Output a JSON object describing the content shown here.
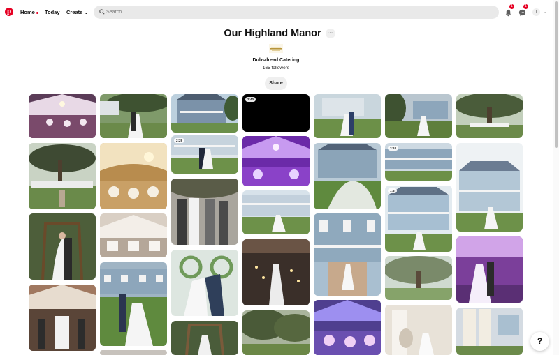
{
  "nav": {
    "home": "Home",
    "today": "Today",
    "create": "Create"
  },
  "search": {
    "placeholder": "Search"
  },
  "notifications": {
    "bell_count": "1",
    "messages_count": "1"
  },
  "account": {
    "initial": "T"
  },
  "board": {
    "title": "Our Highland Manor",
    "more": "···",
    "owner": "Dubsdread Catering",
    "followers": "165 followers",
    "share": "Share"
  },
  "pins": {
    "video_durations": [
      "2:40",
      "2:29",
      "3:24",
      "1:5"
    ]
  },
  "help": {
    "label": "?"
  },
  "icons": {
    "logo": "pinterest-logo-icon",
    "bell": "bell-icon",
    "messages": "chat-icon",
    "search": "search-icon",
    "chevron": "chevron-down-icon",
    "play": "play-icon"
  },
  "colors": {
    "brand": "#e60023"
  }
}
